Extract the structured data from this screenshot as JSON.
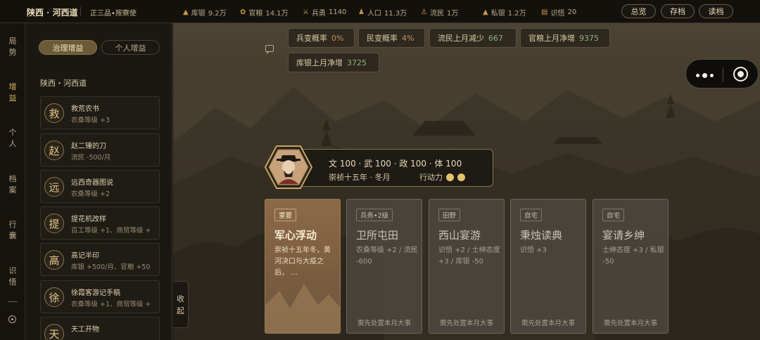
{
  "topbar": {
    "region": "陕西 · 河西道",
    "rank": "正三品•按察使",
    "resources": [
      {
        "icon": "silver-icon",
        "label": "库银",
        "value": "9.2万"
      },
      {
        "icon": "grain-icon",
        "label": "官粮",
        "value": "14.1万"
      },
      {
        "icon": "soldier-icon",
        "label": "兵勇",
        "value": "1140"
      },
      {
        "icon": "population-icon",
        "label": "人口",
        "value": "11.3万"
      },
      {
        "icon": "refugee-icon",
        "label": "流民",
        "value": "1万"
      },
      {
        "icon": "private-silver-icon",
        "label": "私银",
        "value": "1.2万"
      },
      {
        "icon": "knowledge-icon",
        "label": "识悟",
        "value": "20"
      }
    ],
    "buttons": {
      "overview": "总览",
      "save": "存档",
      "load": "读档"
    }
  },
  "rail": {
    "items": [
      {
        "label": "局势"
      },
      {
        "label": "增益",
        "active": true
      },
      {
        "label": "个人"
      },
      {
        "label": "档案"
      },
      {
        "label": "行囊"
      },
      {
        "label": "识悟"
      }
    ]
  },
  "panel": {
    "tabs": [
      {
        "label": "治理增益",
        "active": true
      },
      {
        "label": "个人增益"
      }
    ],
    "title": "陕西・河西道",
    "items": [
      {
        "seal": "救",
        "name": "救荒农书",
        "effect": "农桑等级 +3"
      },
      {
        "seal": "赵",
        "name": "赵二锤的刀",
        "effect": "流民 -500/月"
      },
      {
        "seal": "远",
        "name": "远西奇器图说",
        "effect": "农桑等级 +2"
      },
      {
        "seal": "提",
        "name": "提花机改样",
        "effect": "百工等级 +1、商贸等级 +"
      },
      {
        "seal": "高",
        "name": "高记半印",
        "effect": "库银 +500/月、官粮 +50"
      },
      {
        "seal": "徐",
        "name": "徐霞客游记手稿",
        "effect": "农桑等级 +1、商贸等级 +"
      },
      {
        "seal": "天",
        "name": "天工开物",
        "effect": ""
      }
    ],
    "collapse": [
      "收",
      "起"
    ]
  },
  "stats": [
    {
      "label": "兵变概率",
      "value": "0%",
      "tone": "bad"
    },
    {
      "label": "民变概率",
      "value": "4%",
      "tone": "bad"
    },
    {
      "label": "流民上月减少",
      "value": "667",
      "tone": "good"
    },
    {
      "label": "官粮上月净增",
      "value": "9375",
      "tone": "good"
    },
    {
      "label": "库银上月净增",
      "value": "3725",
      "tone": "good"
    }
  ],
  "character": {
    "attributes": "文 100 · 武 100 · 政 100 · 体 100",
    "date": "崇祯十五年 · 冬月",
    "action_label": "行动力",
    "action_points": 2
  },
  "cards": [
    {
      "tag": "重要",
      "title": "军心浮动",
      "desc": "崇祯十五年冬，黄河决口与大疫之后，  …",
      "foot": "",
      "main": true
    },
    {
      "tag": "兵务•2级",
      "title": "卫所屯田",
      "desc": "农桑等级 +2 / 流民 -600",
      "foot": "需先处置本月大事"
    },
    {
      "tag": "田野",
      "title": "西山宴游",
      "desc": "识悟 +2 / 士绅态度 +3 / 库银 -50",
      "foot": "需先处置本月大事"
    },
    {
      "tag": "自宅",
      "title": "秉烛读典",
      "desc": "识悟 +3",
      "foot": "需先处置本月大事"
    },
    {
      "tag": "自宅",
      "title": "宴请乡绅",
      "desc": "士绅态度 +3 / 私银 -50",
      "foot": "需先处置本月大事"
    }
  ],
  "colors": {
    "accent": "#d9b35e",
    "bad": "#c98a5a",
    "good": "#8fb07c",
    "coin": "#e3c26a"
  }
}
